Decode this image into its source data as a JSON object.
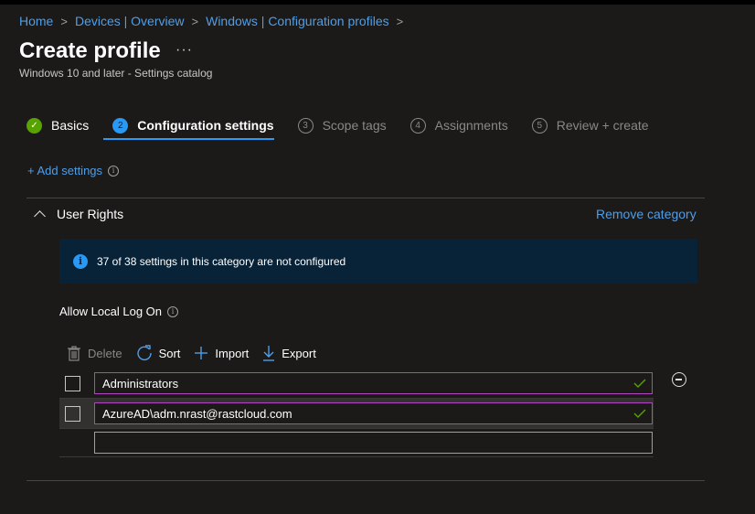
{
  "breadcrumb": {
    "items": [
      "Home",
      "Devices | Overview",
      "Windows | Configuration profiles"
    ],
    "separator": ">"
  },
  "header": {
    "title": "Create profile",
    "more": "···",
    "subtitle": "Windows 10 and later - Settings catalog"
  },
  "steps": [
    {
      "number": "✓",
      "label": "Basics",
      "state": "done"
    },
    {
      "number": "2",
      "label": "Configuration settings",
      "state": "active"
    },
    {
      "number": "3",
      "label": "Scope tags",
      "state": "pending"
    },
    {
      "number": "4",
      "label": "Assignments",
      "state": "pending"
    },
    {
      "number": "5",
      "label": "Review + create",
      "state": "pending"
    }
  ],
  "add_settings": {
    "label": "+ Add settings",
    "info": "i"
  },
  "category": {
    "name": "User Rights",
    "remove_label": "Remove category",
    "info_message": "37 of 38 settings in this category are not configured",
    "info_icon": "i"
  },
  "setting": {
    "label": "Allow Local Log On",
    "info": "i",
    "toolbar": {
      "delete": "Delete",
      "sort": "Sort",
      "import": "Import",
      "export": "Export"
    },
    "values": [
      "Administrators",
      "AzureAD\\adm.nrast@rastcloud.com",
      ""
    ],
    "new_value_placeholder": ""
  },
  "colors": {
    "background": "#1b1a19",
    "link": "#4f9ee8",
    "accent": "#2899f5",
    "success": "#57a300",
    "input_border_active": "#b146c2",
    "infobar": "#082338"
  },
  "icons": {
    "done_step": "checkmark-icon",
    "delete": "trash-icon",
    "sort": "refresh-icon",
    "import": "plus-icon",
    "export": "download-arrow-icon",
    "valid": "checkmark-icon",
    "remove_row": "minus-circle-icon"
  }
}
